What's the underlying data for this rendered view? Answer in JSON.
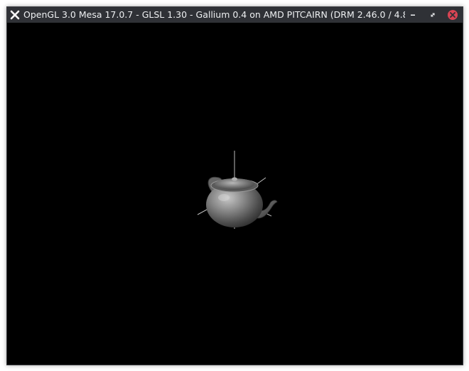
{
  "window": {
    "title": "OpenGL 3.0 Mesa 17.0.7 - GLSL 1.30 - Gallium 0.4 on AMD PITCAIRN (DRM 2.46.0 / 4.8.0-...",
    "app_icon": "x-app-icon",
    "controls": {
      "minimize_icon": "minimize-icon",
      "restore_icon": "restore-icon",
      "close_icon": "close-icon"
    },
    "colors": {
      "titlebar": "#2f3136",
      "title_text": "#eef0f2",
      "close": "#da4453",
      "viewport": "#000000"
    }
  },
  "scene": {
    "object": "teapot",
    "axes": "visible"
  }
}
